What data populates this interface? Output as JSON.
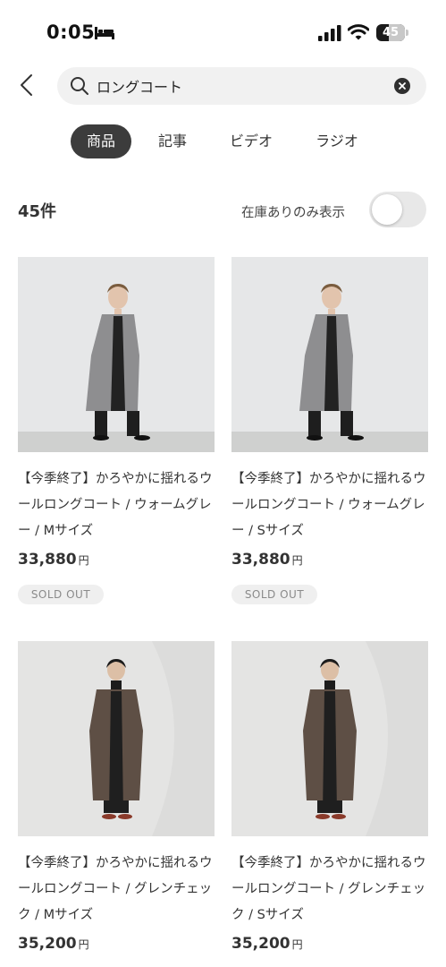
{
  "status_bar": {
    "time": "0:05",
    "battery": "45",
    "battery_level_percent": 45
  },
  "search": {
    "query": "ロングコート",
    "placeholder": ""
  },
  "tabs": [
    {
      "label": "商品",
      "active": true
    },
    {
      "label": "記事",
      "active": false
    },
    {
      "label": "ビデオ",
      "active": false
    },
    {
      "label": "ラジオ",
      "active": false
    }
  ],
  "results": {
    "count": "45件",
    "stock_filter_label": "在庫ありのみ表示",
    "stock_filter_on": false
  },
  "products": [
    {
      "name": "【今季終了】かろやかに揺れるウールロングコート / ウォームグレー / Mサイズ",
      "price": "33,880",
      "unit": "円",
      "badge": "SOLD OUT",
      "coat_color": "#8e8e90"
    },
    {
      "name": "【今季終了】かろやかに揺れるウールロングコート / ウォームグレー / Sサイズ",
      "price": "33,880",
      "unit": "円",
      "badge": "SOLD OUT",
      "coat_color": "#8e8e90"
    },
    {
      "name": "【今季終了】かろやかに揺れるウールロングコート / グレンチェック / Mサイズ",
      "price": "35,200",
      "unit": "円",
      "badge": "",
      "coat_color": "#5e4f45"
    },
    {
      "name": "【今季終了】かろやかに揺れるウールロングコート / グレンチェック / Sサイズ",
      "price": "35,200",
      "unit": "円",
      "badge": "",
      "coat_color": "#5e4f45"
    }
  ],
  "colors": {
    "accent": "#3c3c3c",
    "badge_bg": "#efefef",
    "search_bg": "#f1f1f1"
  }
}
